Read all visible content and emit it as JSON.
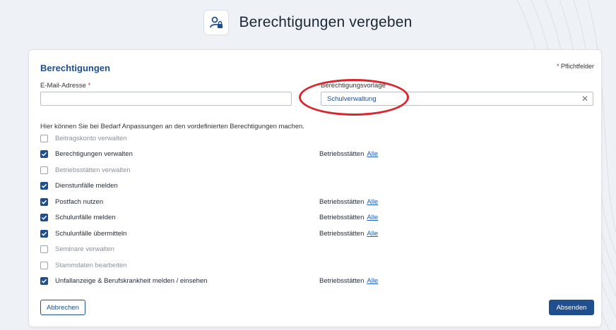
{
  "page": {
    "title": "Berechtigungen vergeben",
    "header_icon": "user-lock-icon"
  },
  "form": {
    "section_title": "Berechtigungen",
    "required_note": "Pflichtfelder",
    "required_star": "*",
    "email_label": "E-Mail-Adresse",
    "email_value": "",
    "template_label": "Berechtigungsvorlage",
    "template_value": "Schulverwaltung",
    "clear_symbol": "✕",
    "hint": "Hier können Sie bei Bedarf Anpassungen an den vordefinierten Berechtigungen machen."
  },
  "permissions": [
    {
      "label": "Beitragskonto verwalten",
      "checked": false,
      "scope_label": "",
      "scope_link": ""
    },
    {
      "label": "Berechtigungen verwalten",
      "checked": true,
      "scope_label": "Betriebsstätten",
      "scope_link": "Alle"
    },
    {
      "label": "Betriebsstätten verwalten",
      "checked": false,
      "scope_label": "",
      "scope_link": ""
    },
    {
      "label": "Dienstunfälle melden",
      "checked": true,
      "scope_label": "",
      "scope_link": ""
    },
    {
      "label": "Postfach nutzen",
      "checked": true,
      "scope_label": "Betriebsstätten",
      "scope_link": "Alle"
    },
    {
      "label": "Schulunfälle melden",
      "checked": true,
      "scope_label": "Betriebsstätten",
      "scope_link": "Alle"
    },
    {
      "label": "Schulunfälle übermitteln",
      "checked": true,
      "scope_label": "Betriebsstätten",
      "scope_link": "Alle"
    },
    {
      "label": "Seminare verwalten",
      "checked": false,
      "scope_label": "",
      "scope_link": ""
    },
    {
      "label": "Stammdaten bearbeiten",
      "checked": false,
      "scope_label": "",
      "scope_link": ""
    },
    {
      "label": "Unfallanzeige & Berufskrankheit melden / einsehen",
      "checked": true,
      "scope_label": "Betriebsstätten",
      "scope_link": "Alle"
    }
  ],
  "actions": {
    "cancel": "Abbrechen",
    "submit": "Absenden"
  },
  "colors": {
    "primary": "#1f4f8f",
    "required": "#d2232a",
    "annotation": "#d9262c"
  }
}
